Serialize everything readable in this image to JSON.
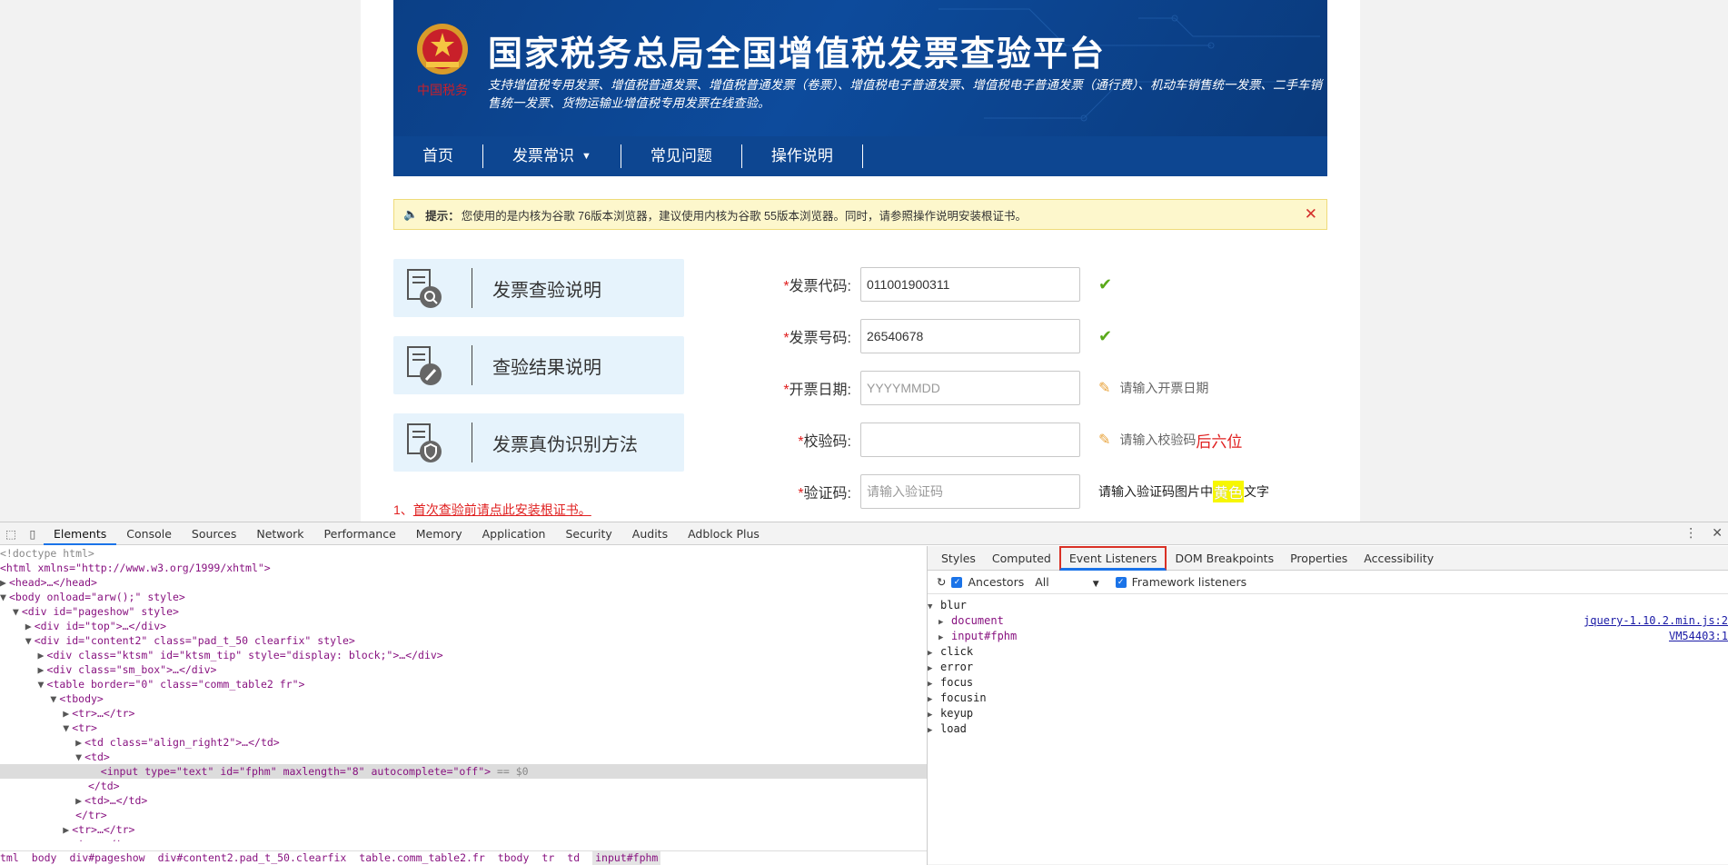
{
  "site": {
    "title": "国家税务总局全国增值税发票查验平台",
    "subtitle": "支持增值税专用发票、增值税普通发票、增值税普通发票（卷票）、增值税电子普通发票、增值税电子普通发票（通行费）、机动车销售统一发票、二手车销售统一发票、货物运输业增值税专用发票在线查验。"
  },
  "nav": {
    "items": [
      "首页",
      "发票常识",
      "常见问题",
      "操作说明"
    ],
    "dropdown_chevron": "chevron-down-icon"
  },
  "notice": {
    "label": "提示：",
    "text": "您使用的是内核为谷歌 76版本浏览器，建议使用内核为谷歌 55版本浏览器。同时，请参照操作说明安装根证书。",
    "close_icon": "✕"
  },
  "side_buttons": [
    {
      "label": "发票查验说明",
      "icon": "document-search-icon"
    },
    {
      "label": "查验结果说明",
      "icon": "document-edit-icon"
    },
    {
      "label": "发票真伪识别方法",
      "icon": "document-shield-icon"
    }
  ],
  "install": {
    "prefix": "1、",
    "link": "首次查验前请点此安装根证书。"
  },
  "form": {
    "required_mark": "*",
    "invoice_code": {
      "label": "发票代码:",
      "value": "011001900311",
      "placeholder": ""
    },
    "invoice_number": {
      "label": "发票号码:",
      "value": "26540678",
      "placeholder": ""
    },
    "issue_date": {
      "label": "开票日期:",
      "value": "",
      "placeholder": "YYYYMMDD",
      "hint": "请输入开票日期"
    },
    "check_code": {
      "label": "校验码:",
      "value": "",
      "placeholder": "",
      "hint": "请输入校验码",
      "hint_red": "后六位"
    },
    "captcha": {
      "label": "验证码:",
      "value": "",
      "placeholder": "请输入验证码",
      "hint_a": "请输入验证码图片中",
      "hint_yellow": "黄色",
      "hint_b": "文字"
    }
  },
  "devtools": {
    "tabs": [
      "Elements",
      "Console",
      "Sources",
      "Network",
      "Performance",
      "Memory",
      "Application",
      "Security",
      "Audits",
      "Adblock Plus"
    ],
    "active_tab": "Elements",
    "sidebar_tabs": [
      "Styles",
      "Computed",
      "Event Listeners",
      "DOM Breakpoints",
      "Properties",
      "Accessibility"
    ],
    "active_sidebar_tab": "Event Listeners",
    "toolbar": {
      "ancestors": "Ancestors",
      "filter": "All",
      "framework": "Framework listeners"
    },
    "listeners": [
      {
        "name": "blur",
        "expanded": true,
        "children": [
          {
            "name": "document",
            "source": "jquery-1.10.2.min.js:2"
          },
          {
            "name": "input#fphm",
            "source": "VM54403:1"
          }
        ]
      },
      {
        "name": "click"
      },
      {
        "name": "error"
      },
      {
        "name": "focus"
      },
      {
        "name": "focusin"
      },
      {
        "name": "keyup"
      },
      {
        "name": "load"
      }
    ],
    "breadcrumbs": [
      "tml",
      "body",
      "div#pageshow",
      "div#content2.pad_t_50.clearfix",
      "table.comm_table2.fr",
      "tbody",
      "tr",
      "td",
      "input#fphm"
    ],
    "dom": {
      "doctype": "<!doctype html>",
      "html_open": "<html xmlns=\"http://www.w3.org/1999/xhtml\">",
      "head": "<head>…</head>",
      "body": "<body onload=\"arw();\" style>",
      "pageshow": "<div id=\"pageshow\" style>",
      "top": "<div id=\"top\">…</div>",
      "content2": "<div id=\"content2\" class=\"pad_t_50 clearfix\" style>",
      "ktsm": "<div class=\"ktsm\" id=\"ktsm_tip\" style=\"display: block;\">…</div>",
      "sm_box": "<div class=\"sm_box\">…</div>",
      "table": "<table border=\"0\" class=\"comm_table2 fr\">",
      "tbody": "<tbody>",
      "tr_collapsed": "<tr>…</tr>",
      "tr_open": "<tr>",
      "td_align": "<td class=\"align_right2\">…</td>",
      "td_open": "<td>",
      "input": "<input type=\"text\" id=\"fphm\" maxlength=\"8\" autocomplete=\"off\">",
      "selected_marker": " == $0",
      "td_close": "</td>",
      "td_collapsed": "<td>…</td>",
      "tr_close": "</tr>"
    }
  }
}
